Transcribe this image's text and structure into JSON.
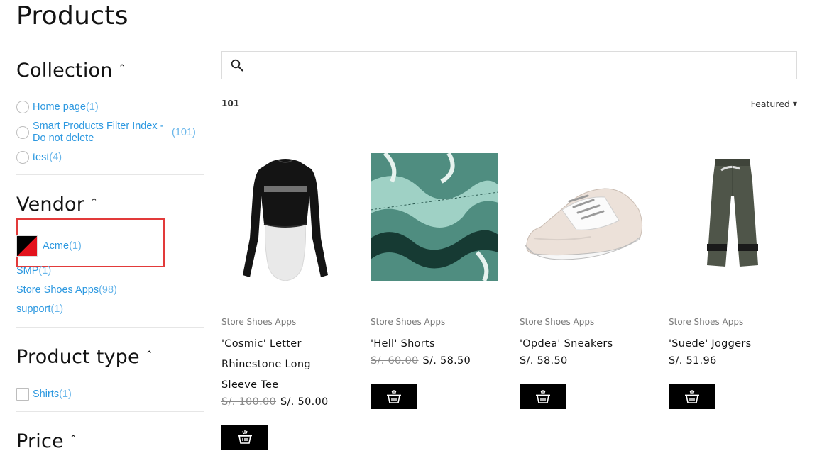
{
  "page": {
    "title": "Products"
  },
  "filters": {
    "collection": {
      "title": "Collection",
      "options": [
        {
          "label": "Home page",
          "count": "(1)"
        },
        {
          "label": "Smart Products Filter Index - Do not delete",
          "count": "(101)"
        },
        {
          "label": "test",
          "count": "(4)"
        }
      ]
    },
    "vendor": {
      "title": "Vendor",
      "options": [
        {
          "label": "Acme",
          "count": "(1)"
        },
        {
          "label": "SMP",
          "count": "(1)"
        },
        {
          "label": "Store Shoes Apps",
          "count": "(98)"
        },
        {
          "label": "support",
          "count": "(1)"
        }
      ]
    },
    "product_type": {
      "title": "Product type",
      "options": [
        {
          "label": "Shirts",
          "count": "(1)"
        }
      ]
    },
    "price": {
      "title": "Price"
    }
  },
  "search": {
    "placeholder": "",
    "value": ""
  },
  "results": {
    "count": "101",
    "sort_label": "Featured"
  },
  "products": [
    {
      "vendor": "Store Shoes Apps",
      "name": "'Cosmic' Letter Rhinestone Long Sleeve Tee",
      "old_price": "S/. 100.00",
      "price": "S/. 50.00"
    },
    {
      "vendor": "Store Shoes Apps",
      "name": "'Hell' Shorts",
      "old_price": "S/. 60.00",
      "price": "S/. 58.50"
    },
    {
      "vendor": "Store Shoes Apps",
      "name": "'Opdea' Sneakers",
      "old_price": "",
      "price": "S/. 58.50"
    },
    {
      "vendor": "Store Shoes Apps",
      "name": "'Suede' Joggers",
      "old_price": "",
      "price": "S/. 51.96"
    }
  ],
  "colors": {
    "link": "#2c98e0",
    "highlight": "#e23a3a",
    "cart_button": "#000000"
  },
  "icons": {
    "search": "search-icon",
    "cart": "shopping-basket-icon",
    "chevron": "chevron-up-icon"
  }
}
